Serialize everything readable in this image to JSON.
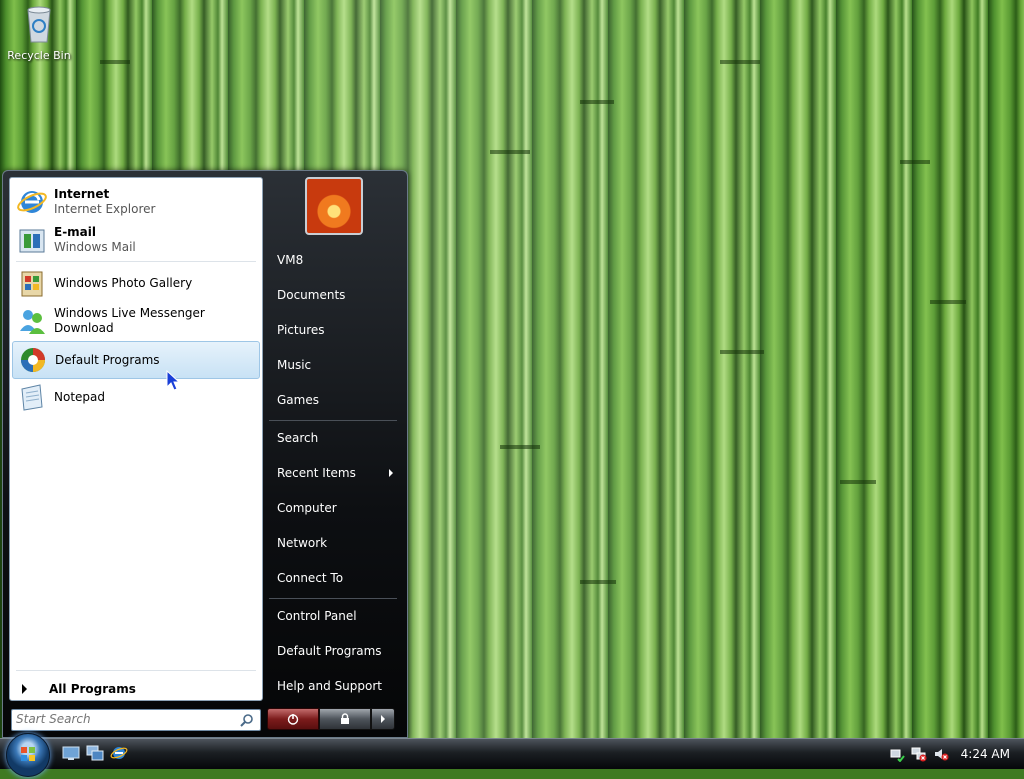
{
  "desktop": {
    "icons": [
      {
        "label": "Recycle Bin",
        "icon": "recycle-bin-icon"
      }
    ]
  },
  "start_menu": {
    "pinned": [
      {
        "title": "Internet",
        "subtitle": "Internet Explorer",
        "icon": "internet-explorer-icon"
      },
      {
        "title": "E-mail",
        "subtitle": "Windows Mail",
        "icon": "windows-mail-icon"
      }
    ],
    "recent": [
      {
        "label": "Windows Photo Gallery",
        "icon": "photo-gallery-icon"
      },
      {
        "label": "Windows Live Messenger Download",
        "icon": "messenger-icon"
      },
      {
        "label": "Default Programs",
        "icon": "default-programs-icon",
        "highlighted": true
      },
      {
        "label": "Notepad",
        "icon": "notepad-icon"
      }
    ],
    "all_programs": "All Programs",
    "search_placeholder": "Start Search",
    "places": [
      {
        "label": "VM8"
      },
      {
        "label": "Documents"
      },
      {
        "label": "Pictures"
      },
      {
        "label": "Music"
      },
      {
        "label": "Games"
      },
      {
        "label": "Search"
      },
      {
        "label": "Recent Items",
        "has_submenu": true
      },
      {
        "label": "Computer"
      },
      {
        "label": "Network"
      },
      {
        "label": "Connect To"
      },
      {
        "label": "Control Panel"
      },
      {
        "label": "Default Programs"
      },
      {
        "label": "Help and Support"
      }
    ]
  },
  "taskbar": {
    "clock": "4:24 AM",
    "quick_launch": [
      "show-desktop-icon",
      "switch-windows-icon",
      "internet-explorer-icon"
    ],
    "tray_icons": [
      "network-icon",
      "network-disconnected-icon",
      "volume-muted-icon"
    ]
  },
  "colors": {
    "accent": "#3b78b7",
    "menu_dark": "#0d0f12",
    "highlight": "#c8e2f5"
  }
}
